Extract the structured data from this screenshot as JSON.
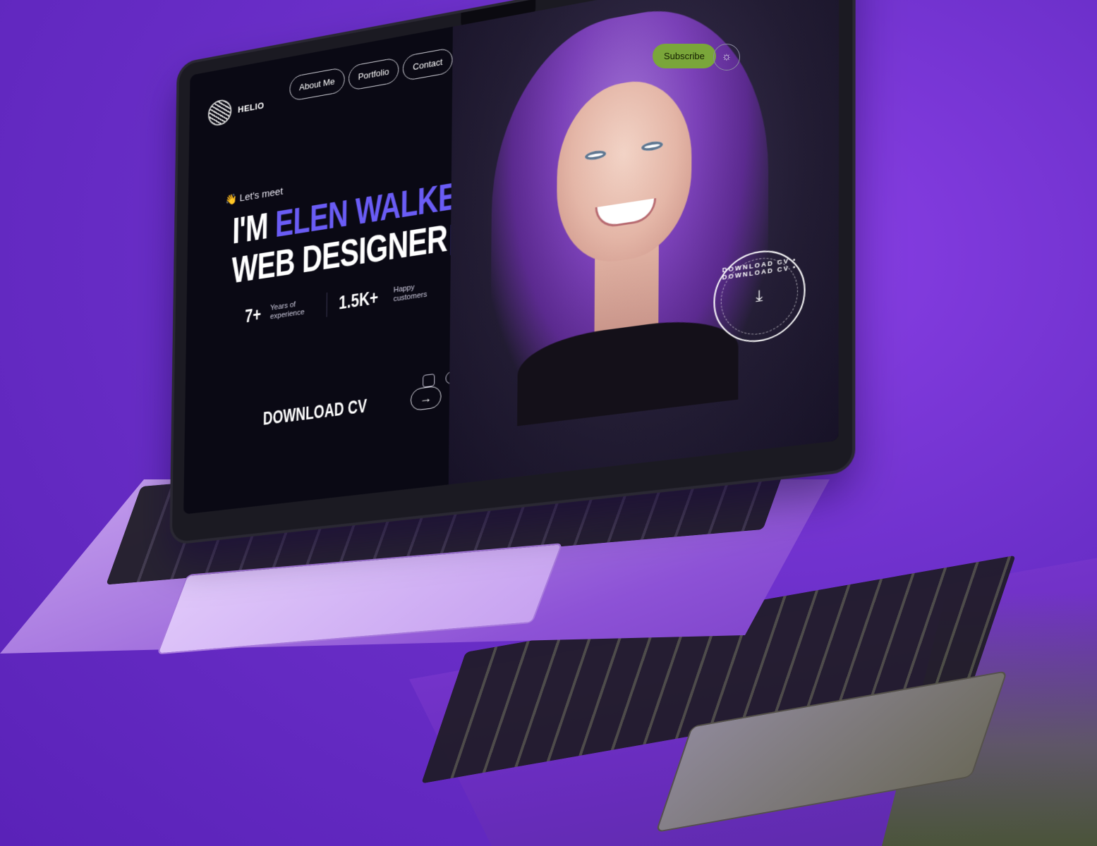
{
  "brand": {
    "name": "HELIO",
    "logo_icon": "helio-logo-icon"
  },
  "nav": {
    "items": [
      "About Me",
      "Portfolio",
      "Contact"
    ]
  },
  "header": {
    "subscribe_label": "Subscribe",
    "theme_icon": "sun-icon"
  },
  "hero": {
    "greeting": "👋 Let's meet",
    "line1_prefix": "I'M ",
    "line1_accent": "ELEN WALKER",
    "line2": "WEB DESIGNER",
    "accent_color": "#6a5cf5"
  },
  "stats": [
    {
      "value": "7+",
      "caption": "Years of experience"
    },
    {
      "value": "1.5K+",
      "caption": "Happy customers"
    }
  ],
  "download": {
    "label": "DOWNLOAD CV",
    "arrow_icon": "arrow-right-icon"
  },
  "socials": [
    "figma-icon",
    "dribbble-icon",
    "instagram-icon"
  ],
  "badge": {
    "text": "DOWNLOAD CV • DOWNLOAD CV •",
    "icon": "download-icon"
  },
  "colors": {
    "background": "#6b2fc9",
    "screen_bg": "#0a0914",
    "subscribe": "#7aa63a"
  }
}
